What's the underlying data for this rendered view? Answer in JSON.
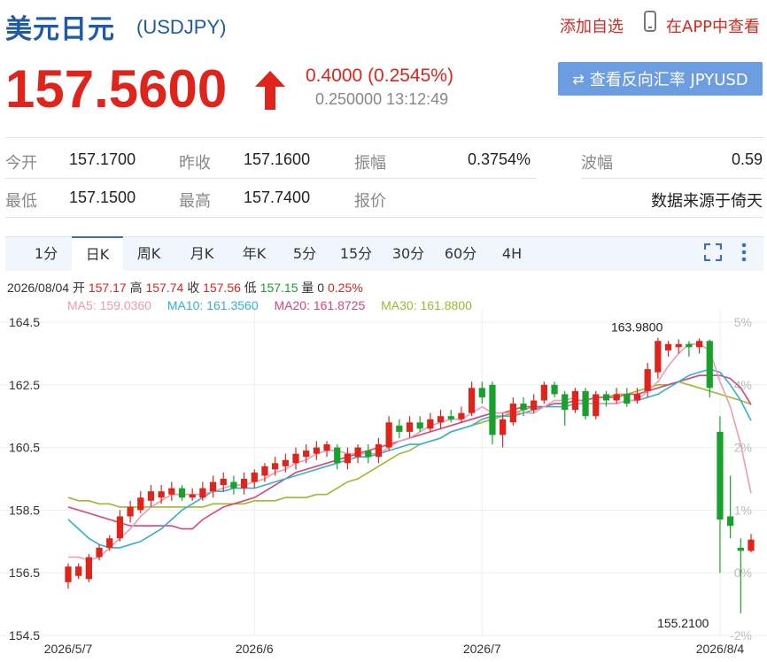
{
  "header": {
    "title": "美元日元",
    "symbol": "(USDJPY)",
    "add_favorite": "添加自选",
    "view_in_app": "在APP中查看"
  },
  "quote": {
    "price": "157.5600",
    "change": "0.4000 (0.2545%)",
    "spread_time": "0.250000 13:12:49",
    "direction": "up"
  },
  "reverse_button": "查看反向汇率 JPYUSD",
  "stats": {
    "open_label": "今开",
    "open": "157.1700",
    "prev_close_label": "昨收",
    "prev_close": "157.1600",
    "amplitude_label": "振幅",
    "amplitude": "0.3754%",
    "volatility_label": "波幅",
    "volatility": "0.59",
    "low_label": "最低",
    "low": "157.1500",
    "high_label": "最高",
    "high": "157.7400",
    "quote_label": "报价",
    "source": "数据来源于倚天"
  },
  "tabs": [
    "1分",
    "日K",
    "周K",
    "月K",
    "年K",
    "5分",
    "15分",
    "30分",
    "60分",
    "4H"
  ],
  "active_tab": 1,
  "chart_info": {
    "date": "2026/08/04",
    "open_label": "开",
    "open": "157.17",
    "high_label": "高",
    "high": "157.74",
    "close_label": "收",
    "close": "157.56",
    "low_label": "低",
    "low": "157.15",
    "vol_label": "量",
    "vol": "0",
    "pct": "0.25%",
    "ma5": "MA5: 159.0360",
    "ma10": "MA10: 161.3560",
    "ma20": "MA20: 161.8725",
    "ma30": "MA30: 161.8800"
  },
  "colors": {
    "up": "#e0241b",
    "down": "#19a22b",
    "ma5": "#f09ab5",
    "ma10": "#31b2d4",
    "ma20": "#e0427a",
    "ma30": "#9bbb2c",
    "accent": "#1f5aa8",
    "button": "#6b9de0"
  },
  "chart_data": {
    "type": "candlestick",
    "ylim": [
      154.5,
      164.5
    ],
    "y_ticks": [
      "164.5",
      "162.5",
      "160.5",
      "158.5",
      "156.5",
      "154.5"
    ],
    "right_ticks": [
      "5%",
      "4%",
      "2%",
      "1%",
      "0%",
      "-2%"
    ],
    "x_labels": [
      {
        "label": "2026/5/7",
        "index": 0
      },
      {
        "label": "2026/6",
        "index": 18
      },
      {
        "label": "2026/7",
        "index": 40
      },
      {
        "label": "2026/8/4",
        "index": 63
      }
    ],
    "max_label": "163.9800",
    "min_label": "155.2100",
    "max_index": 56,
    "min_index": 62,
    "annotation_max_value": 163.98,
    "annotation_min_value": 155.21,
    "candles": [
      [
        156.2,
        156.7,
        156.0,
        156.8
      ],
      [
        156.4,
        156.7,
        156.3,
        156.8
      ],
      [
        156.3,
        157.0,
        156.2,
        157.1
      ],
      [
        157.0,
        157.3,
        156.9,
        157.4
      ],
      [
        157.3,
        157.6,
        157.2,
        157.7
      ],
      [
        157.6,
        158.3,
        157.5,
        158.5
      ],
      [
        158.3,
        158.6,
        158.1,
        158.8
      ],
      [
        158.5,
        158.9,
        158.4,
        159.1
      ],
      [
        158.8,
        159.1,
        158.6,
        159.3
      ],
      [
        158.9,
        159.1,
        158.7,
        159.3
      ],
      [
        159.0,
        159.2,
        158.8,
        159.4
      ],
      [
        159.2,
        158.9,
        158.8,
        159.3
      ],
      [
        158.9,
        159.0,
        158.8,
        159.2
      ],
      [
        158.9,
        159.2,
        158.8,
        159.4
      ],
      [
        159.1,
        159.4,
        158.9,
        159.6
      ],
      [
        159.3,
        159.5,
        159.1,
        159.7
      ],
      [
        159.4,
        159.2,
        159.0,
        159.6
      ],
      [
        159.2,
        159.5,
        159.0,
        159.7
      ],
      [
        159.4,
        159.7,
        159.2,
        159.8
      ],
      [
        159.6,
        159.9,
        159.4,
        160.0
      ],
      [
        159.8,
        160.0,
        159.6,
        160.2
      ],
      [
        159.9,
        160.1,
        159.7,
        160.3
      ],
      [
        160.0,
        160.3,
        159.8,
        160.5
      ],
      [
        160.2,
        160.4,
        160.0,
        160.6
      ],
      [
        160.3,
        160.5,
        160.1,
        160.7
      ],
      [
        160.4,
        160.6,
        160.2,
        160.7
      ],
      [
        160.5,
        160.0,
        159.8,
        160.6
      ],
      [
        160.0,
        160.3,
        159.8,
        160.5
      ],
      [
        160.2,
        160.5,
        160.0,
        160.6
      ],
      [
        160.4,
        160.2,
        160.0,
        160.6
      ],
      [
        160.2,
        160.6,
        160.0,
        160.8
      ],
      [
        160.5,
        161.3,
        160.4,
        161.5
      ],
      [
        161.2,
        161.0,
        160.8,
        161.4
      ],
      [
        161.0,
        161.3,
        160.8,
        161.5
      ],
      [
        161.3,
        161.1,
        161.0,
        161.5
      ],
      [
        161.1,
        161.4,
        161.0,
        161.6
      ],
      [
        161.3,
        161.5,
        161.1,
        161.7
      ],
      [
        161.5,
        161.4,
        161.3,
        161.7
      ],
      [
        161.4,
        161.6,
        161.3,
        161.8
      ],
      [
        161.6,
        162.4,
        161.5,
        162.6
      ],
      [
        162.4,
        162.1,
        161.9,
        162.6
      ],
      [
        162.5,
        160.9,
        160.6,
        162.6
      ],
      [
        160.9,
        161.4,
        160.5,
        161.6
      ],
      [
        161.3,
        161.9,
        161.2,
        162.1
      ],
      [
        161.9,
        161.7,
        161.5,
        162.1
      ],
      [
        161.7,
        162.0,
        161.6,
        162.2
      ],
      [
        162.0,
        162.5,
        161.9,
        162.6
      ],
      [
        162.5,
        162.2,
        162.1,
        162.6
      ],
      [
        162.2,
        161.7,
        161.2,
        162.3
      ],
      [
        161.7,
        162.3,
        161.6,
        162.4
      ],
      [
        162.3,
        161.5,
        161.4,
        162.4
      ],
      [
        161.5,
        162.2,
        161.4,
        162.3
      ],
      [
        162.2,
        162.0,
        161.8,
        162.3
      ],
      [
        162.0,
        162.2,
        161.9,
        162.4
      ],
      [
        162.2,
        161.9,
        161.8,
        162.4
      ],
      [
        162.0,
        162.2,
        161.9,
        162.4
      ],
      [
        162.3,
        163.0,
        162.1,
        163.2
      ],
      [
        162.9,
        163.9,
        162.7,
        164.0
      ],
      [
        163.6,
        163.8,
        163.4,
        163.9
      ],
      [
        163.7,
        163.8,
        163.5,
        163.95
      ],
      [
        163.8,
        163.7,
        163.4,
        163.9
      ],
      [
        163.7,
        163.9,
        163.5,
        163.98
      ],
      [
        163.9,
        162.4,
        162.1,
        163.95
      ],
      [
        161.0,
        158.2,
        156.5,
        161.5
      ],
      [
        158.3,
        158.0,
        157.6,
        159.6
      ],
      [
        157.3,
        157.2,
        155.21,
        157.6
      ],
      [
        157.2,
        157.56,
        157.15,
        157.74
      ]
    ],
    "ma5": [
      157.0,
      157.0,
      156.9,
      157.0,
      157.3,
      157.6,
      157.9,
      158.3,
      158.6,
      158.8,
      159.0,
      159.0,
      159.0,
      159.0,
      159.1,
      159.2,
      159.3,
      159.3,
      159.4,
      159.5,
      159.7,
      159.8,
      160.0,
      160.1,
      160.3,
      160.4,
      160.4,
      160.3,
      160.3,
      160.3,
      160.3,
      160.5,
      160.7,
      160.8,
      161.0,
      161.2,
      161.3,
      161.4,
      161.4,
      161.6,
      161.8,
      161.6,
      161.6,
      161.6,
      161.6,
      161.6,
      161.8,
      162.0,
      162.0,
      162.1,
      161.9,
      161.9,
      161.9,
      161.9,
      162.0,
      162.0,
      162.3,
      162.6,
      163.1,
      163.5,
      163.8,
      163.8,
      163.6,
      162.6,
      161.8,
      160.6,
      159.04
    ],
    "ma10": [
      158.2,
      157.9,
      157.6,
      157.4,
      157.3,
      157.3,
      157.4,
      157.5,
      157.7,
      157.9,
      158.2,
      158.5,
      158.7,
      158.9,
      159.1,
      159.1,
      159.2,
      159.2,
      159.2,
      159.3,
      159.4,
      159.5,
      159.6,
      159.7,
      159.8,
      159.9,
      160.0,
      160.1,
      160.2,
      160.2,
      160.3,
      160.4,
      160.5,
      160.6,
      160.6,
      160.7,
      160.8,
      161.0,
      161.1,
      161.2,
      161.4,
      161.5,
      161.5,
      161.5,
      161.6,
      161.7,
      161.8,
      161.8,
      161.8,
      161.9,
      161.9,
      161.9,
      161.9,
      161.9,
      162.0,
      162.0,
      162.1,
      162.2,
      162.4,
      162.6,
      162.8,
      162.9,
      163.0,
      162.9,
      162.5,
      162.0,
      161.36
    ],
    "ma20": [
      158.6,
      158.5,
      158.4,
      158.3,
      158.2,
      158.1,
      158.0,
      158.0,
      158.0,
      158.0,
      158.0,
      157.9,
      157.9,
      158.2,
      158.4,
      158.6,
      158.7,
      158.8,
      158.9,
      159.1,
      159.3,
      159.5,
      159.7,
      159.8,
      159.9,
      160.0,
      160.1,
      160.2,
      160.3,
      160.4,
      160.5,
      160.6,
      160.7,
      160.8,
      160.9,
      161.0,
      161.1,
      161.2,
      161.3,
      161.4,
      161.5,
      161.6,
      161.6,
      161.7,
      161.8,
      161.8,
      161.8,
      161.9,
      161.9,
      162.0,
      162.0,
      162.1,
      162.1,
      162.1,
      162.2,
      162.2,
      162.3,
      162.4,
      162.5,
      162.6,
      162.7,
      162.8,
      162.8,
      162.8,
      162.7,
      162.4,
      161.87
    ],
    "ma30": [
      158.9,
      158.8,
      158.8,
      158.7,
      158.7,
      158.6,
      158.6,
      158.6,
      158.6,
      158.6,
      158.6,
      158.6,
      158.6,
      158.6,
      158.7,
      158.7,
      158.7,
      158.7,
      158.8,
      158.8,
      158.8,
      158.9,
      158.9,
      158.9,
      159.0,
      159.0,
      159.2,
      159.4,
      159.5,
      159.7,
      159.9,
      160.1,
      160.3,
      160.4,
      160.6,
      160.7,
      160.8,
      161.0,
      161.1,
      161.2,
      161.3,
      161.4,
      161.5,
      161.6,
      161.7,
      161.8,
      161.8,
      161.9,
      161.9,
      162.0,
      162.0,
      162.1,
      162.1,
      162.2,
      162.2,
      162.3,
      162.4,
      162.5,
      162.5,
      162.6,
      162.5,
      162.4,
      162.3,
      162.2,
      162.1,
      162.0,
      161.88
    ]
  }
}
